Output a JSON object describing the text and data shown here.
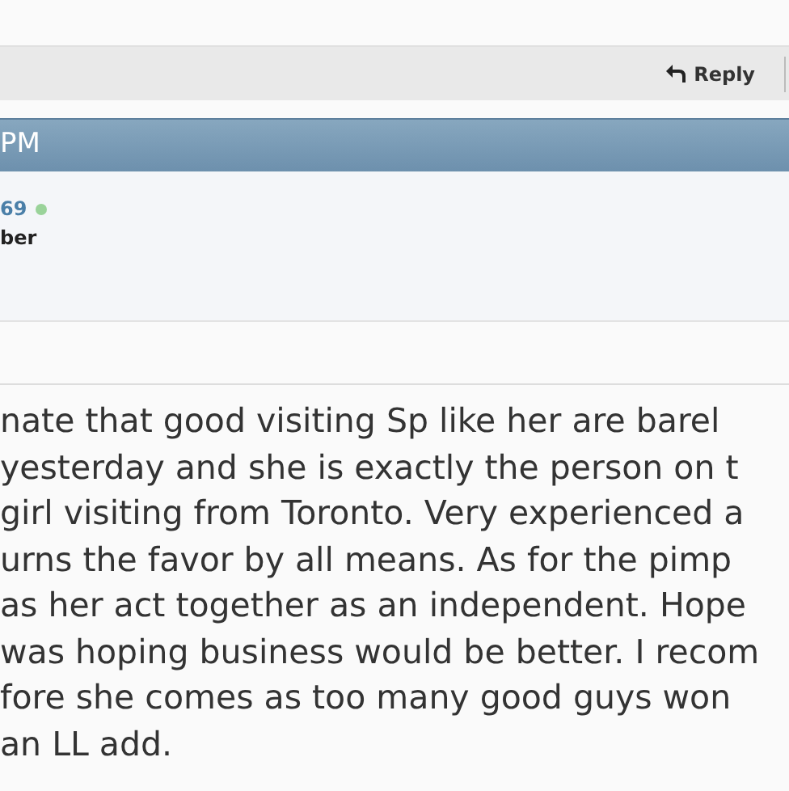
{
  "toolbar": {
    "reply_button": "Reply"
  },
  "post_header": {
    "time": "PM"
  },
  "user": {
    "name": "69",
    "online": true,
    "rank": "ber"
  },
  "post_lines": [
    "nate that good visiting Sp like her are barel",
    "yesterday and she is exactly the person on t",
    "girl visiting from Toronto. Very experienced a",
    "urns the favor by all means. As for the pimp",
    "as her act together as an independent. Hope",
    "was hoping business would be better. I recom",
    "fore she comes as too many good guys won",
    "an LL add."
  ]
}
